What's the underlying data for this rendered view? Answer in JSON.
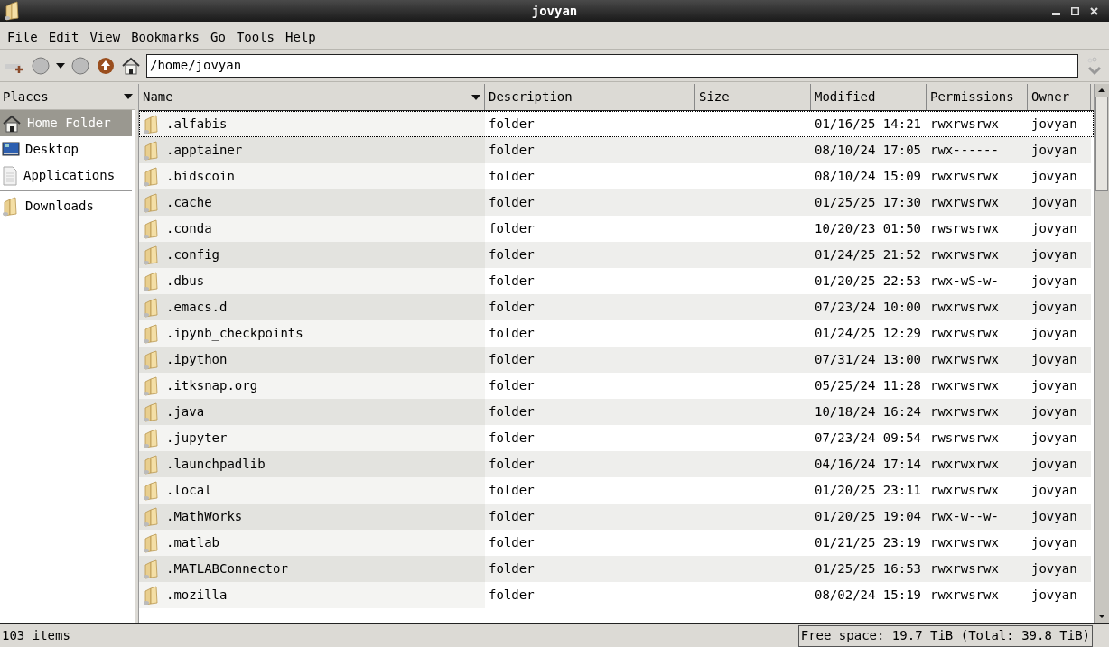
{
  "window": {
    "title": "jovyan"
  },
  "menu": [
    "File",
    "Edit",
    "View",
    "Bookmarks",
    "Go",
    "Tools",
    "Help"
  ],
  "location": {
    "value": "/home/jovyan"
  },
  "places": {
    "title": "Places",
    "items": [
      {
        "label": "Home Folder",
        "kind": "home",
        "selected": true,
        "separated": false
      },
      {
        "label": "Desktop",
        "kind": "desktop",
        "selected": false,
        "separated": false
      },
      {
        "label": "Applications",
        "kind": "document",
        "selected": false,
        "separated": false
      },
      {
        "label": "Downloads",
        "kind": "folder",
        "selected": false,
        "separated": true
      }
    ]
  },
  "table": {
    "columns": [
      {
        "label": "Name",
        "sorted": true
      },
      {
        "label": "Description",
        "sorted": false
      },
      {
        "label": "Size",
        "sorted": false
      },
      {
        "label": "Modified",
        "sorted": false
      },
      {
        "label": "Permissions",
        "sorted": false
      },
      {
        "label": "Owner",
        "sorted": false
      }
    ],
    "rows": [
      {
        "name": ".alfabis",
        "description": "folder",
        "modified": "01/16/25 14:21",
        "permissions": "rwxrwsrwx",
        "owner": "jovyan",
        "focused": true
      },
      {
        "name": ".apptainer",
        "description": "folder",
        "modified": "08/10/24 17:05",
        "permissions": "rwx------",
        "owner": "jovyan",
        "focused": false
      },
      {
        "name": ".bidscoin",
        "description": "folder",
        "modified": "08/10/24 15:09",
        "permissions": "rwxrwsrwx",
        "owner": "jovyan",
        "focused": false
      },
      {
        "name": ".cache",
        "description": "folder",
        "modified": "01/25/25 17:30",
        "permissions": "rwxrwsrwx",
        "owner": "jovyan",
        "focused": false
      },
      {
        "name": ".conda",
        "description": "folder",
        "modified": "10/20/23 01:50",
        "permissions": "rwsrwsrwx",
        "owner": "jovyan",
        "focused": false
      },
      {
        "name": ".config",
        "description": "folder",
        "modified": "01/24/25 21:52",
        "permissions": "rwxrwsrwx",
        "owner": "jovyan",
        "focused": false
      },
      {
        "name": ".dbus",
        "description": "folder",
        "modified": "01/20/25 22:53",
        "permissions": "rwx-wS-w-",
        "owner": "jovyan",
        "focused": false
      },
      {
        "name": ".emacs.d",
        "description": "folder",
        "modified": "07/23/24 10:00",
        "permissions": "rwxrwsrwx",
        "owner": "jovyan",
        "focused": false
      },
      {
        "name": ".ipynb_checkpoints",
        "description": "folder",
        "modified": "01/24/25 12:29",
        "permissions": "rwxrwsrwx",
        "owner": "jovyan",
        "focused": false
      },
      {
        "name": ".ipython",
        "description": "folder",
        "modified": "07/31/24 13:00",
        "permissions": "rwxrwsrwx",
        "owner": "jovyan",
        "focused": false
      },
      {
        "name": ".itksnap.org",
        "description": "folder",
        "modified": "05/25/24 11:28",
        "permissions": "rwxrwsrwx",
        "owner": "jovyan",
        "focused": false
      },
      {
        "name": ".java",
        "description": "folder",
        "modified": "10/18/24 16:24",
        "permissions": "rwxrwsrwx",
        "owner": "jovyan",
        "focused": false
      },
      {
        "name": ".jupyter",
        "description": "folder",
        "modified": "07/23/24 09:54",
        "permissions": "rwsrwsrwx",
        "owner": "jovyan",
        "focused": false
      },
      {
        "name": ".launchpadlib",
        "description": "folder",
        "modified": "04/16/24 17:14",
        "permissions": "rwxrwxrwx",
        "owner": "jovyan",
        "focused": false
      },
      {
        "name": ".local",
        "description": "folder",
        "modified": "01/20/25 23:11",
        "permissions": "rwxrwsrwx",
        "owner": "jovyan",
        "focused": false
      },
      {
        "name": ".MathWorks",
        "description": "folder",
        "modified": "01/20/25 19:04",
        "permissions": "rwx-w--w-",
        "owner": "jovyan",
        "focused": false
      },
      {
        "name": ".matlab",
        "description": "folder",
        "modified": "01/21/25 23:19",
        "permissions": "rwxrwsrwx",
        "owner": "jovyan",
        "focused": false
      },
      {
        "name": ".MATLABConnector",
        "description": "folder",
        "modified": "01/25/25 16:53",
        "permissions": "rwxrwsrwx",
        "owner": "jovyan",
        "focused": false
      },
      {
        "name": ".mozilla",
        "description": "folder",
        "modified": "08/02/24 15:19",
        "permissions": "rwxrwsrwx",
        "owner": "jovyan",
        "focused": false
      }
    ]
  },
  "status_bar": {
    "items": "103 items",
    "free_space": "Free space: 19.7 TiB (Total: 39.8 TiB)"
  }
}
